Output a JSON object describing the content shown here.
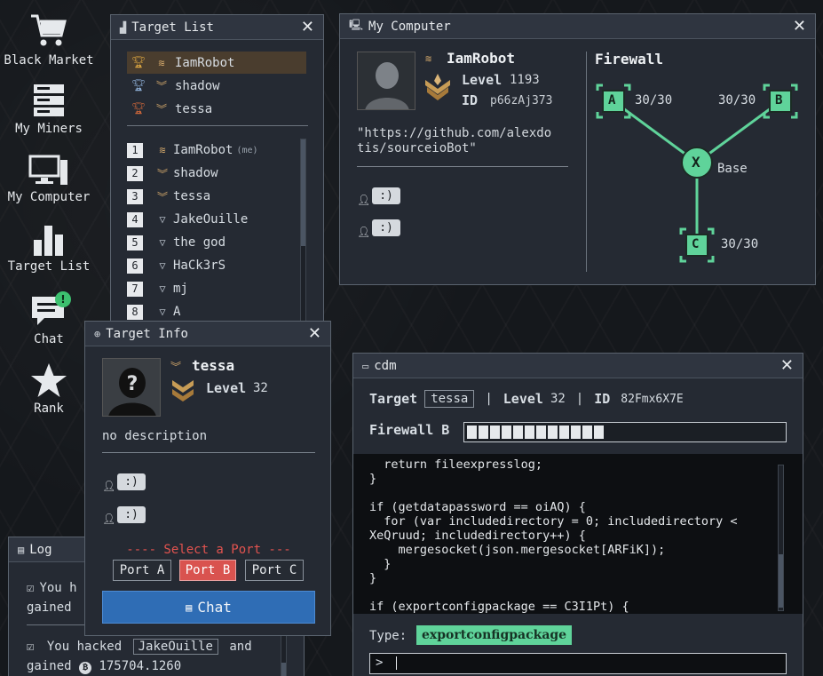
{
  "desktop": {
    "icons": [
      {
        "label": "Black Market",
        "icon": "cart-icon"
      },
      {
        "label": "My Miners",
        "icon": "server-icon"
      },
      {
        "label": "My Computer",
        "icon": "computer-icon"
      },
      {
        "label": "Target List",
        "icon": "bar-chart-icon"
      },
      {
        "label": "Chat",
        "icon": "chat-icon",
        "badge": "!"
      },
      {
        "label": "Rank",
        "icon": "star-icon"
      }
    ]
  },
  "target_list": {
    "title": "Target List",
    "top": [
      {
        "name": "IamRobot",
        "cup_color": "#d9a441"
      },
      {
        "name": "shadow",
        "cup_color": "#8fb0d8"
      },
      {
        "name": "tessa",
        "cup_color": "#c9653a"
      }
    ],
    "rows": [
      {
        "num": "1",
        "name": "IamRobot",
        "me": "(me)"
      },
      {
        "num": "2",
        "name": "shadow",
        "me": ""
      },
      {
        "num": "3",
        "name": "tessa",
        "me": ""
      },
      {
        "num": "4",
        "name": "JakeOuille",
        "me": ""
      },
      {
        "num": "5",
        "name": "the god",
        "me": ""
      },
      {
        "num": "6",
        "name": "HaCk3rS",
        "me": ""
      },
      {
        "num": "7",
        "name": "mj",
        "me": ""
      },
      {
        "num": "8",
        "name": "A",
        "me": ""
      }
    ]
  },
  "my_computer": {
    "title": "My Computer",
    "name": "IamRobot",
    "level_label": "Level",
    "level": "1193",
    "id_label": "ID",
    "id": "p66zAj373",
    "description": "\"https://github.com/alexdotis/sourceioBot\"",
    "desc_line1": "\"https://github.com/alexdo",
    "desc_line2": "tis/sourceioBot\"",
    "chats": [
      ":)",
      ":)"
    ],
    "firewall": {
      "title": "Firewall",
      "base_label": "Base",
      "nodes": [
        {
          "letter": "A",
          "value": "30/30"
        },
        {
          "letter": "B",
          "value": "30/30"
        },
        {
          "letter": "C",
          "value": "30/30"
        }
      ],
      "center": "X",
      "accent": "#5fd39a"
    }
  },
  "target_info": {
    "title": "Target Info",
    "name": "tessa",
    "level_label": "Level",
    "level": "32",
    "description": "no description",
    "chats": [
      ":)",
      ":)"
    ],
    "select_port": "---- Select a Port ---",
    "ports": [
      {
        "label": "Port A",
        "active": false
      },
      {
        "label": "Port B",
        "active": true
      },
      {
        "label": "Port C",
        "active": false
      }
    ],
    "chat_button": "Chat"
  },
  "log": {
    "title": "Log",
    "entries": [
      {
        "text1": "You h",
        "text2": "gained"
      },
      {
        "prefix": "You hacked",
        "target": "JakeOuille",
        "suffix": "and",
        "gained": "gained",
        "amount": "175704.1260"
      }
    ]
  },
  "cdm": {
    "title": "cdm",
    "target_label": "Target",
    "target": "tessa",
    "level_label": "Level",
    "level": "32",
    "id_label": "ID",
    "id": "82Fmx6X7E",
    "firewall_label": "Firewall B",
    "progress_blocks": 12,
    "code": [
      "  return fileexpresslog;",
      "}",
      "",
      "if (getdatapassword == oiAQ) {",
      "  for (var includedirectory = 0; includedirectory <",
      "XeQruud; includedirectory++) {",
      "    mergesocket(json.mergesocket[ARFiK]);",
      "  }",
      "}",
      "",
      "if (exportconfigpackage == C3I1Pt) {"
    ],
    "type_label": "Type:",
    "type_word": "exportconfigpackage",
    "prompt": ">"
  },
  "colors": {
    "accent_green": "#5fd39a",
    "port_active": "#d9534f",
    "chat_button": "#2f6db5"
  }
}
